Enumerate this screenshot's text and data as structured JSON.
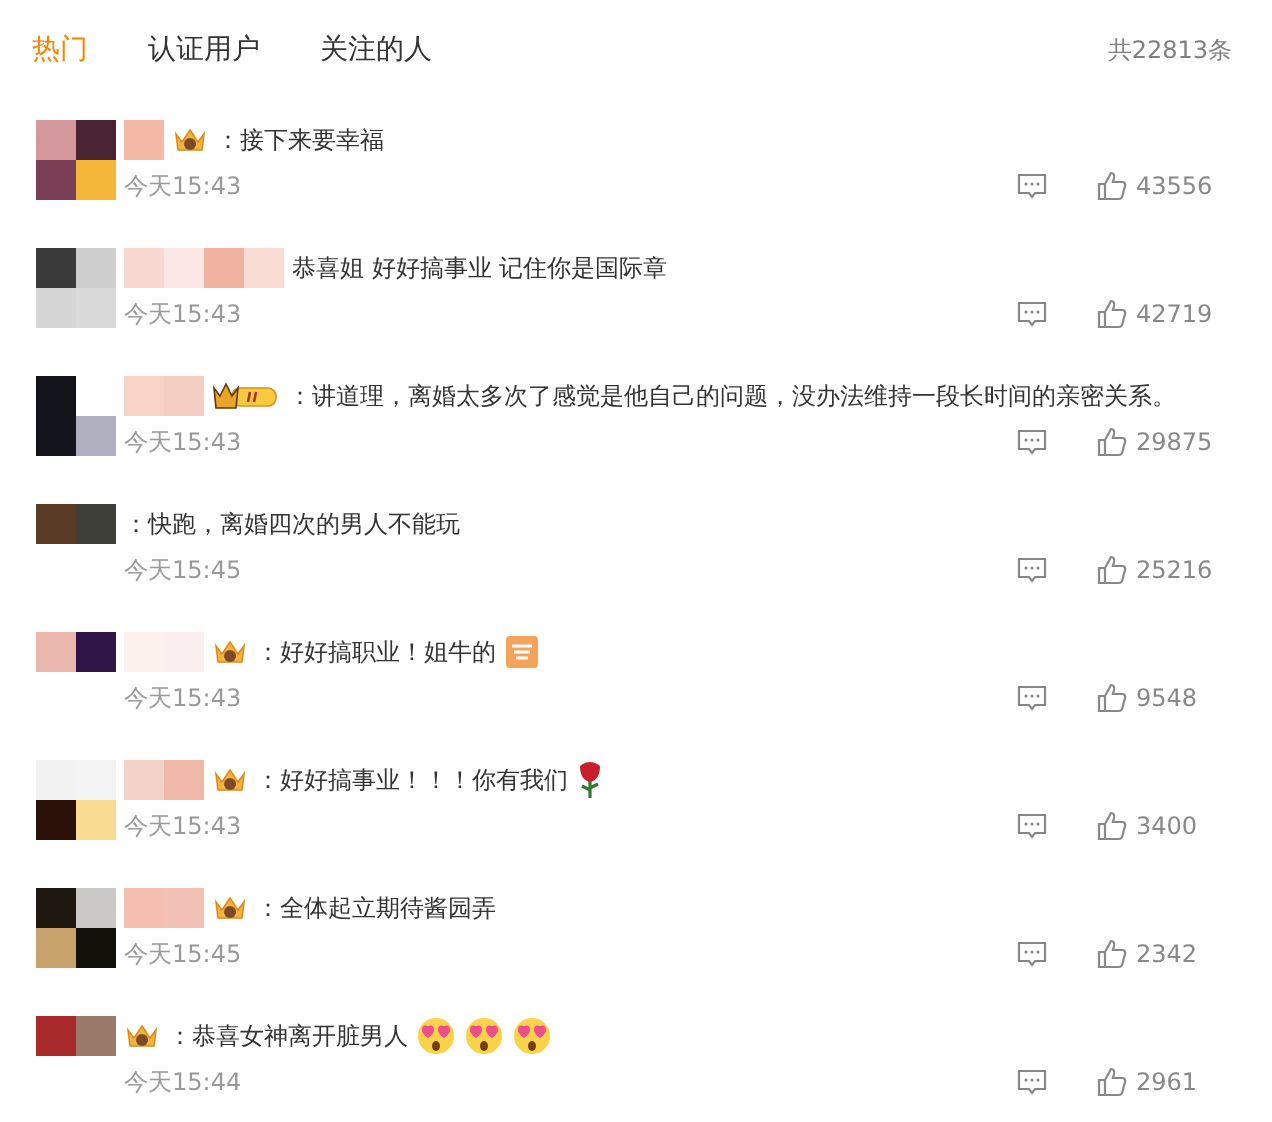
{
  "tabs": [
    {
      "label": "热门",
      "selected": true
    },
    {
      "label": "认证用户",
      "selected": false
    },
    {
      "label": "关注的人",
      "selected": false
    }
  ],
  "total": "共22813条",
  "comments": [
    {
      "badge": {
        "kind": "crown"
      },
      "text": "：接下来要幸福",
      "time": "今天15:43",
      "likes": "43556"
    },
    {
      "text": "恭喜姐 好好搞事业 记住你是国际章",
      "time": "今天15:43",
      "likes": "42719"
    },
    {
      "badge": {
        "kind": "crownlevel"
      },
      "text": "：讲道理，离婚太多次了感觉是他自己的问题，没办法维持一段长时间的亲密关系。",
      "time": "今天15:43",
      "likes": "29875"
    },
    {
      "text": "：快跑，离婚四次的男人不能玩",
      "time": "今天15:45",
      "likes": "25216"
    },
    {
      "badge": {
        "kind": "crown"
      },
      "text": "：好好搞职业！姐牛的",
      "time": "今天15:43",
      "likes": "9548",
      "emoji": [
        {
          "kind": "praise"
        }
      ]
    },
    {
      "badge": {
        "kind": "crown"
      },
      "text": "：好好搞事业！！！你有我们",
      "time": "今天15:43",
      "likes": "3400",
      "emoji": [
        {
          "kind": "rose"
        }
      ]
    },
    {
      "badge": {
        "kind": "crown"
      },
      "text": "：全体起立期待酱园弄",
      "time": "今天15:45",
      "likes": "2342"
    },
    {
      "badge": {
        "kind": "crown"
      },
      "text": "：恭喜女神离开脏男人",
      "time": "今天15:44",
      "likes": "2961",
      "emoji": [
        {
          "kind": "hearteyes"
        },
        {
          "kind": "hearteyes"
        },
        {
          "kind": "hearteyes"
        }
      ]
    }
  ]
}
